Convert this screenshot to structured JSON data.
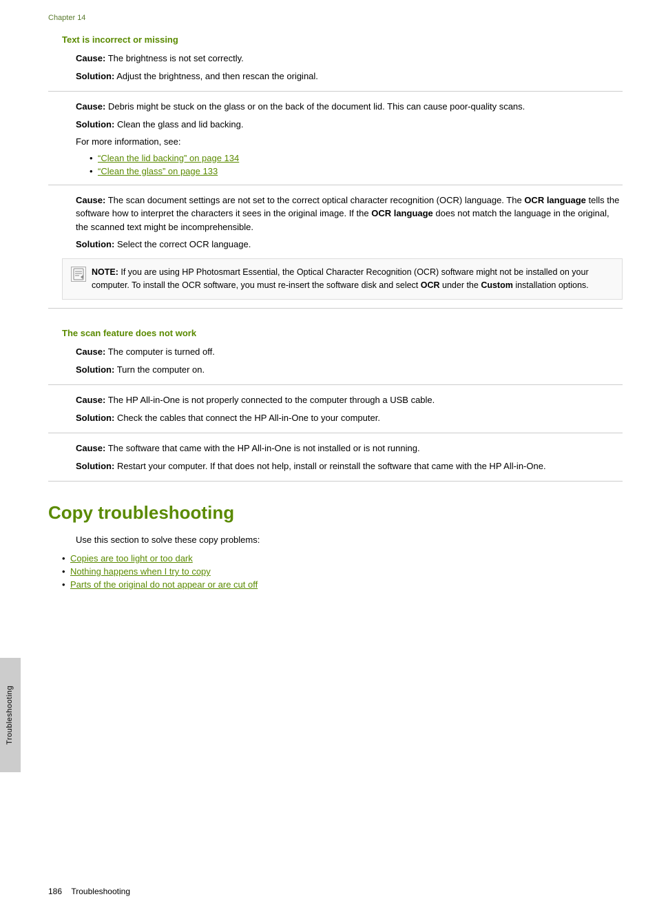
{
  "chapter": {
    "label": "Chapter 14"
  },
  "sidebar": {
    "label": "Troubleshooting"
  },
  "section1": {
    "heading": "Text is incorrect or missing",
    "entries": [
      {
        "cause_label": "Cause:",
        "cause_text": "   The brightness is not set correctly.",
        "solution_label": "Solution:",
        "solution_text": "   Adjust the brightness, and then rescan the original."
      },
      {
        "cause_label": "Cause:",
        "cause_text": "   Debris might be stuck on the glass or on the back of the document lid. This can cause poor-quality scans.",
        "solution_label": "Solution:",
        "solution_text": "   Clean the glass and lid backing.",
        "extra_text": "For more information, see:",
        "links": [
          {
            "text": "“Clean the lid backing” on page 134"
          },
          {
            "text": "“Clean the glass” on page 133"
          }
        ]
      },
      {
        "cause_label": "Cause:",
        "cause_text": "   The scan document settings are not set to the correct optical character recognition (OCR) language. The ",
        "cause_bold1": "OCR language",
        "cause_mid": " tells the software how to interpret the characters it sees in the original image. If the ",
        "cause_bold2": "OCR language",
        "cause_end": " does not match the language in the original, the scanned text might be incomprehensible.",
        "solution_label": "Solution:",
        "solution_text": "   Select the correct OCR language."
      }
    ],
    "note": {
      "prefix": "NOTE:",
      "text": "  If you are using HP Photosmart Essential, the Optical Character Recognition (OCR) software might not be installed on your computer. To install the OCR software, you must re-insert the software disk and select ",
      "bold1": "OCR",
      "mid": " under the ",
      "bold2": "Custom",
      "end": " installation options."
    }
  },
  "section2": {
    "heading": "The scan feature does not work",
    "entries": [
      {
        "cause_label": "Cause:",
        "cause_text": "   The computer is turned off.",
        "solution_label": "Solution:",
        "solution_text": "   Turn the computer on."
      },
      {
        "cause_label": "Cause:",
        "cause_text": "   The HP All-in-One is not properly connected to the computer through a USB cable.",
        "solution_label": "Solution:",
        "solution_text": "   Check the cables that connect the HP All-in-One to your computer."
      },
      {
        "cause_label": "Cause:",
        "cause_text": "   The software that came with the HP All-in-One is not installed or is not running.",
        "solution_label": "Solution:",
        "solution_text": "   Restart your computer. If that does not help, install or reinstall the software that came with the HP All-in-One."
      }
    ]
  },
  "copy_section": {
    "heading": "Copy troubleshooting",
    "intro": "Use this section to solve these copy problems:",
    "links": [
      {
        "text": "Copies are too light or too dark"
      },
      {
        "text": "Nothing happens when I try to copy"
      },
      {
        "text": "Parts of the original do not appear or are cut off"
      }
    ]
  },
  "footer": {
    "page_number": "186",
    "label": "Troubleshooting"
  }
}
